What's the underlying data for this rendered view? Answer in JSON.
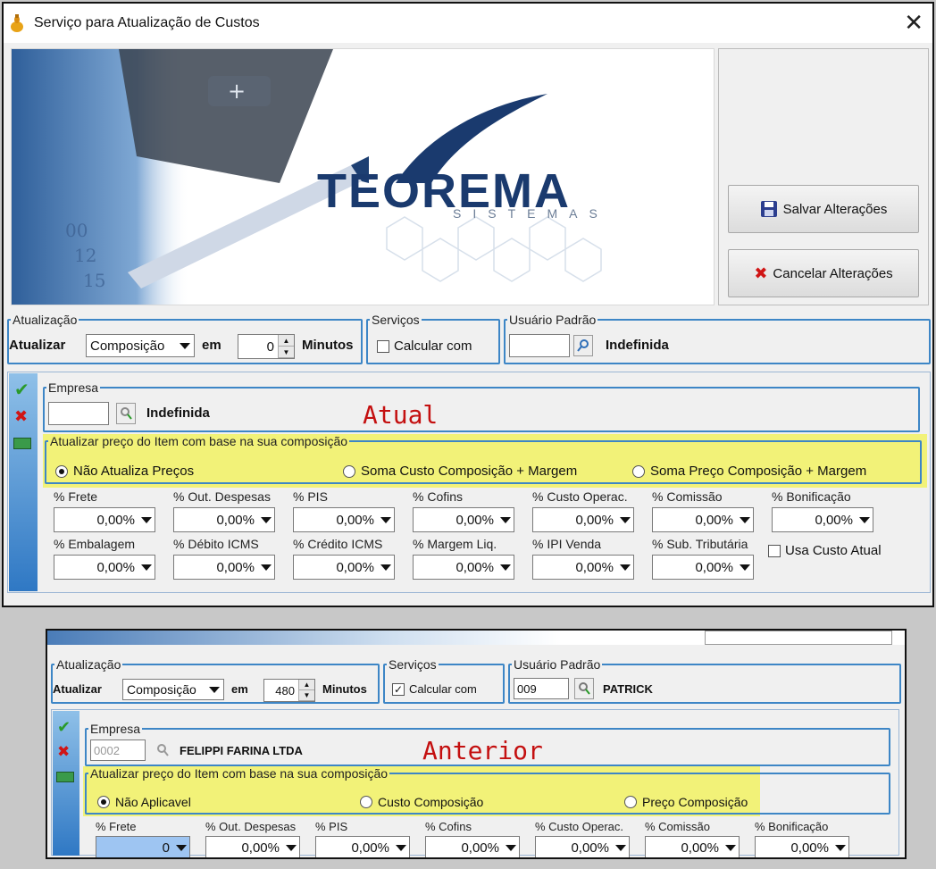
{
  "window": {
    "title": "Serviço para Atualização de Custos",
    "close_glyph": "✕"
  },
  "banner": {
    "logo_main": "TEOREMA",
    "logo_sub": "SISTEMAS"
  },
  "actions": {
    "save_label": "Salvar Alterações",
    "cancel_label": "Cancelar Alterações"
  },
  "atual": {
    "atualizacao": {
      "legend": "Atualização",
      "label": "Atualizar",
      "mode": "Composição",
      "em": "em",
      "minutes": "0",
      "unit": "Minutos"
    },
    "servicos": {
      "legend": "Serviços",
      "checkbox_label": "Calcular com",
      "checked": false
    },
    "usuario": {
      "legend": "Usuário Padrão",
      "code": "",
      "name": "Indefinida"
    },
    "empresa": {
      "legend": "Empresa",
      "code": "",
      "name": "Indefinida"
    },
    "composicao": {
      "legend": "Atualizar preço do Item com base na sua composição",
      "options": [
        "Não Atualiza Preços",
        "Soma Custo Composição + Margem",
        "Soma Preço Composição + Margem"
      ],
      "selected": 0
    },
    "fields_row1": [
      {
        "label": "% Frete",
        "value": "0,00%"
      },
      {
        "label": "% Out. Despesas",
        "value": "0,00%"
      },
      {
        "label": "% PIS",
        "value": "0,00%"
      },
      {
        "label": "% Cofins",
        "value": "0,00%"
      },
      {
        "label": "% Custo Operac.",
        "value": "0,00%"
      },
      {
        "label": "% Comissão",
        "value": "0,00%"
      },
      {
        "label": "% Bonificação",
        "value": "0,00%"
      }
    ],
    "fields_row2": [
      {
        "label": "% Embalagem",
        "value": "0,00%"
      },
      {
        "label": "% Débito ICMS",
        "value": "0,00%"
      },
      {
        "label": "% Crédito ICMS",
        "value": "0,00%"
      },
      {
        "label": "% Margem Liq.",
        "value": "0,00%"
      },
      {
        "label": "% IPI Venda",
        "value": "0,00%"
      },
      {
        "label": "% Sub. Tributária",
        "value": "0,00%"
      }
    ],
    "usa_custo_atual": {
      "label": "Usa Custo Atual",
      "checked": false
    }
  },
  "anterior": {
    "atualizacao": {
      "legend": "Atualização",
      "label": "Atualizar",
      "mode": "Composição",
      "em": "em",
      "minutes": "480",
      "unit": "Minutos"
    },
    "servicos": {
      "legend": "Serviços",
      "checkbox_label": "Calcular com",
      "checked": true
    },
    "usuario": {
      "legend": "Usuário Padrão",
      "code": "009",
      "name": "PATRICK"
    },
    "empresa": {
      "legend": "Empresa",
      "code": "0002",
      "name": "FELIPPI FARINA LTDA"
    },
    "composicao": {
      "legend": "Atualizar preço do Item com base na sua composição",
      "options": [
        "Não Aplicavel",
        "Custo Composição",
        "Preço Composição"
      ],
      "selected": 0
    },
    "fields_row1": [
      {
        "label": "% Frete",
        "value": "0"
      },
      {
        "label": "% Out. Despesas",
        "value": "0,00%"
      },
      {
        "label": "% PIS",
        "value": "0,00%"
      },
      {
        "label": "% Cofins",
        "value": "0,00%"
      },
      {
        "label": "% Custo Operac.",
        "value": "0,00%"
      },
      {
        "label": "% Comissão",
        "value": "0,00%"
      },
      {
        "label": "% Bonificação",
        "value": "0,00%"
      }
    ]
  },
  "annotations": {
    "atual": "Atual",
    "anterior": "Anterior"
  },
  "colors": {
    "highlight": "#f2f25a",
    "group_border": "#3d86c6",
    "annotation": "#c41010",
    "logo": "#1a3a6e"
  }
}
